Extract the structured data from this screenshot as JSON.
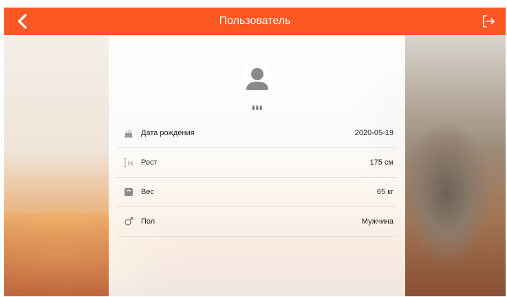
{
  "header": {
    "title": "Пользователь",
    "back_icon": "chevron-left-icon",
    "logout_icon": "logout-icon",
    "background_color": "#fb5722"
  },
  "profile": {
    "avatar_icon": "user-avatar-icon",
    "username": "iiiiiiii"
  },
  "rows": [
    {
      "icon": "birthday-cake-icon",
      "label": "Дата рождения",
      "value": "2020-05-19"
    },
    {
      "icon": "height-icon",
      "label": "Рост",
      "value": "175 см"
    },
    {
      "icon": "scale-icon",
      "label": "Вес",
      "value": "65 кг"
    },
    {
      "icon": "gender-icon",
      "label": "Пол",
      "value": "Мужчина"
    }
  ]
}
